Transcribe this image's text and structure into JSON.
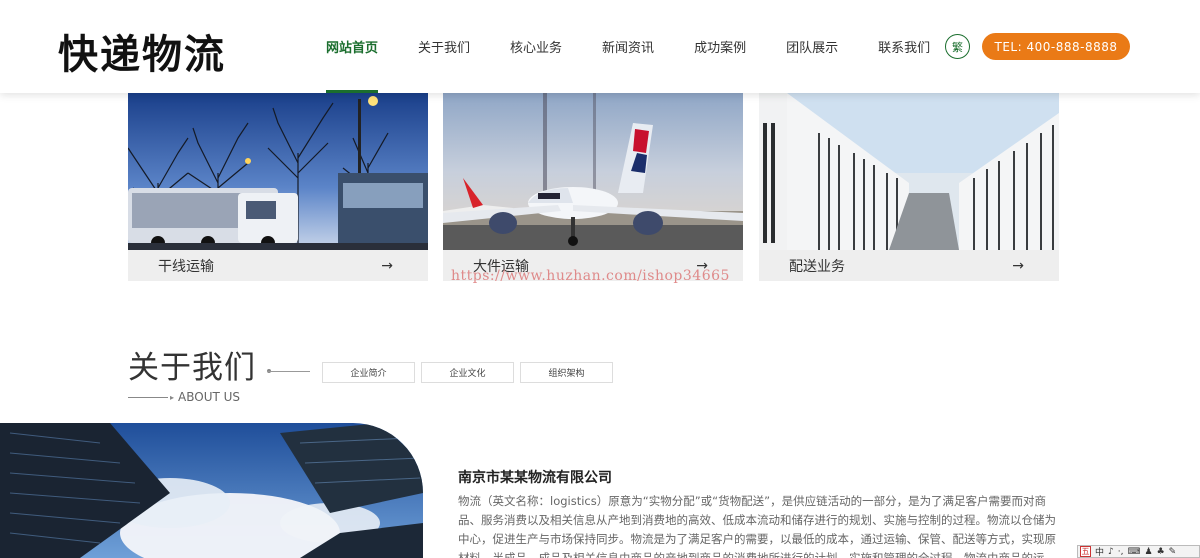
{
  "header": {
    "logo": "快递物流",
    "nav": [
      {
        "label": "网站首页",
        "active": true
      },
      {
        "label": "关于我们"
      },
      {
        "label": "核心业务"
      },
      {
        "label": "新闻资讯"
      },
      {
        "label": "成功案例"
      },
      {
        "label": "团队展示"
      },
      {
        "label": "联系我们"
      }
    ],
    "lang_label": "繁",
    "tel": "TEL: 400-888-8888"
  },
  "services": [
    {
      "title": "干线运输",
      "arrow": "→"
    },
    {
      "title": "大件运输",
      "arrow": "→"
    },
    {
      "title": "配送业务",
      "arrow": "→"
    }
  ],
  "watermark": "https://www.huzhan.com/ishop34665",
  "about": {
    "title": "关于我们",
    "subtitle": "ABOUT US",
    "tabs": [
      "企业简介",
      "企业文化",
      "组织架构"
    ],
    "company_name": "南京市某某物流有限公司",
    "description": "物流（英文名称：logistics）原意为“实物分配”或“货物配送”，是供应链活动的一部分，是为了满足客户需要而对商品、服务消费以及相关信息从产地到消费地的高效、低成本流动和储存进行的规划、实施与控制的过程。物流以仓储为中心，促进生产与市场保持同步。物流是为了满足客户的需要，以最低的成本，通过运输、保管、配送等方式，实现原材料、半成品、成品及相关信息由商品的产地到商品的消费地所进行的计划、实施和管理的全过程。物流由商品的运输、配送、仓储、包装、搬"
  },
  "ime": {
    "items": [
      "中",
      "♪",
      "·,",
      "⌨",
      "♟",
      "♣",
      "✎"
    ]
  },
  "colors": {
    "accent_green": "#1b6e2e",
    "accent_orange": "#ea7a16"
  }
}
